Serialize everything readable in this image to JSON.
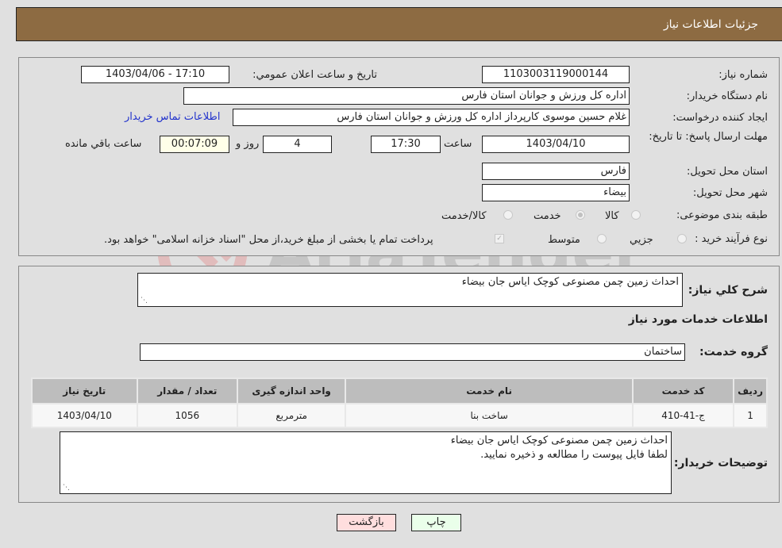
{
  "header": {
    "title": "جزئیات اطلاعات نیاز"
  },
  "fields": {
    "need_number_label": "شماره نیاز:",
    "need_number": "1103003119000144",
    "announce_label": "تاریخ و ساعت اعلان عمومي:",
    "announce_value": "1403/04/06 - 17:10",
    "buyer_org_label": "نام دستگاه خریدار:",
    "buyer_org": "اداره کل ورزش و جوانان استان فارس",
    "creator_label": "ایجاد کننده درخواست:",
    "creator": "غلام حسین موسوی کارپرداز اداره کل ورزش و جوانان استان فارس",
    "contact_link": "اطلاعات تماس خریدار",
    "deadline_label": "مهلت ارسال پاسخ: تا تاریخ:",
    "deadline_date": "1403/04/10",
    "time_label": "ساعت",
    "deadline_time": "17:30",
    "days_value": "4",
    "days_label": "روز و",
    "remaining_value": "00:07:09",
    "remaining_label": "ساعت باقي مانده",
    "province_label": "استان محل تحویل:",
    "province": "فارس",
    "city_label": "شهر محل تحویل:",
    "city": "بیضاء",
    "category_label": "طبقه بندی موضوعی:",
    "category_options": [
      "کالا",
      "خدمت",
      "کالا/خدمت"
    ],
    "category_selected": "خدمت",
    "process_label": "نوع فرآیند خرید :",
    "process_options": [
      "جزيي",
      "متوسط"
    ],
    "treasury_note": "پرداخت تمام یا بخشی از مبلغ خرید،از محل \"اسناد خزانه اسلامی\" خواهد بود."
  },
  "details": {
    "summary_label": "شرح کلي نیاز:",
    "summary": "احداث زمین چمن مصنوعی کوچک ایاس جان بیضاء",
    "services_heading": "اطلاعات خدمات مورد نیاز",
    "service_group_label": "گروه خدمت:",
    "service_group": "ساختمان",
    "table": {
      "headers": [
        "ردیف",
        "کد خدمت",
        "نام خدمت",
        "واحد اندازه گیری",
        "تعداد / مقدار",
        "تاریخ نیاز"
      ],
      "rows": [
        [
          "1",
          "ج-41-410",
          "ساخت بنا",
          "مترمربع",
          "1056",
          "1403/04/10"
        ]
      ]
    },
    "buyer_notes_label": "توضیحات خریدار:",
    "buyer_notes_line1": "احداث زمین چمن مصنوعی کوچک ایاس جان بیضاء",
    "buyer_notes_line2": "لطفا فایل پیوست را مطالعه و ذخیره نمایید."
  },
  "buttons": {
    "back": "بازگشت",
    "print": "چاپ"
  },
  "watermark": {
    "text": "AriaTender.neT"
  },
  "colors": {
    "header_bg": "#8d6b42",
    "back_bg": "#ffdede",
    "print_bg": "#eaffea",
    "link": "#2233cc"
  }
}
